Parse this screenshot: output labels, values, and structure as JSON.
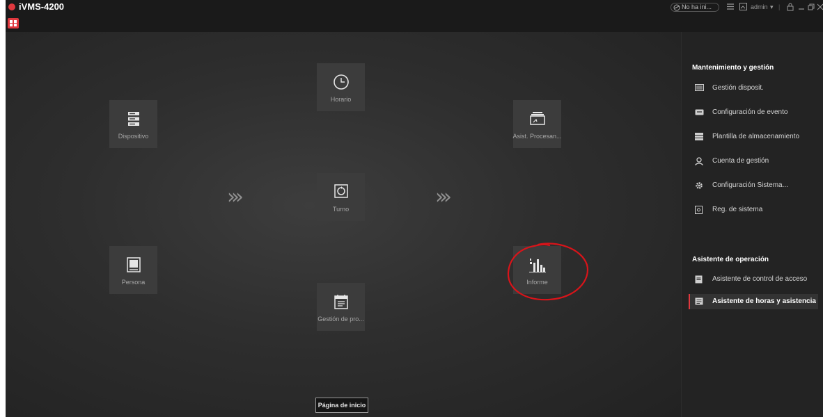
{
  "app": {
    "title": "iVMS-4200"
  },
  "titlebar": {
    "status": "No ha ini...",
    "user": "admin"
  },
  "tiles": {
    "horario": "Horario",
    "dispositivo": "Dispositivo",
    "asist": "Asist. Procesan...",
    "turno": "Turno",
    "persona": "Persona",
    "informe": "Informe",
    "gestion": "Gestión de pro..."
  },
  "home_button": "Página de inicio",
  "sidebar": {
    "maintenance_title": "Mantenimiento y gestión",
    "maintenance_items": [
      {
        "label": "Gestión disposit.",
        "icon": "device-management-icon"
      },
      {
        "label": "Configuración de evento",
        "icon": "event-config-icon"
      },
      {
        "label": "Plantilla de almacenamiento",
        "icon": "storage-template-icon"
      },
      {
        "label": "Cuenta de gestión",
        "icon": "account-icon"
      },
      {
        "label": "Configuración Sistema...",
        "icon": "gear-icon"
      },
      {
        "label": "Reg. de sistema",
        "icon": "system-log-icon"
      }
    ],
    "assistant_title": "Asistente de operación",
    "assistant_items": [
      {
        "label": "Asistente de control de acceso",
        "icon": "access-control-icon"
      },
      {
        "label": "Asistente de horas y asistencia",
        "icon": "attendance-icon",
        "active": true
      }
    ]
  },
  "colors": {
    "accent": "#e0383e",
    "background": "#232323",
    "tile": "#3c3c3c",
    "annotation": "#d9141a"
  }
}
